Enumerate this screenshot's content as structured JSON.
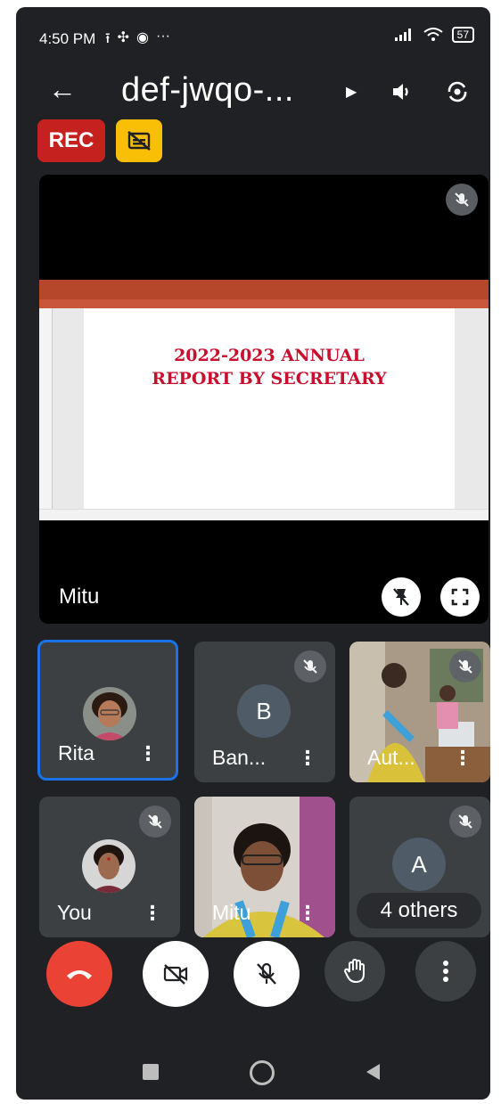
{
  "status_bar": {
    "time": "4:50 PM",
    "battery": "57",
    "left_icons": [
      "upload-icon",
      "pinwheel-icon",
      "chrome-icon",
      "more-dots-icon"
    ],
    "right_icons": [
      "signal-icon",
      "wifi-icon",
      "battery-icon"
    ]
  },
  "app_bar": {
    "meeting_title": "def-jwqo-...",
    "icons": [
      "back-arrow-icon",
      "caret-right-icon",
      "speaker-icon",
      "switch-camera-icon"
    ]
  },
  "badges": {
    "rec": "REC",
    "captions_icon": "captions-off-icon"
  },
  "main_tile": {
    "presenter": "Mitu",
    "slide_text": "2022-2023 ANNUAL\nREPORT BY SECRETARY",
    "icons": [
      "mic-off-icon",
      "unpin-icon",
      "fullscreen-icon"
    ]
  },
  "participants": [
    {
      "name": "Rita",
      "type": "photo",
      "muted": false,
      "active": true
    },
    {
      "name": "Ban...",
      "type": "letter",
      "letter": "B",
      "muted": true,
      "active": false
    },
    {
      "name": "Aut...",
      "type": "video",
      "muted": true,
      "active": false
    },
    {
      "name": "You",
      "type": "photo",
      "muted": true,
      "active": false
    },
    {
      "name": "Mitu",
      "type": "video",
      "muted": false,
      "active": false
    },
    {
      "name": "4 others",
      "type": "group",
      "letter": "A",
      "muted": true,
      "active": false
    }
  ],
  "controls": [
    {
      "name": "end-call-button",
      "icon": "phone-hangup-icon",
      "color": "#ea4335"
    },
    {
      "name": "camera-toggle-button",
      "icon": "camera-off-icon",
      "color": "#ffffff"
    },
    {
      "name": "mic-toggle-button",
      "icon": "mic-off-icon",
      "color": "#ffffff"
    },
    {
      "name": "raise-hand-button",
      "icon": "hand-icon",
      "color": "#3c4043"
    },
    {
      "name": "more-options-button",
      "icon": "more-vertical-icon",
      "color": "#3c4043"
    }
  ],
  "nav_bar": {
    "icons": [
      "recents-icon",
      "home-icon",
      "back-icon"
    ]
  },
  "colors": {
    "background": "#202124",
    "tile": "#3c4043",
    "active_border": "#1a73e8",
    "rec": "#c5221f",
    "captions_badge": "#f9bf06",
    "end_call": "#ea4335",
    "slide_text": "#c8102e"
  }
}
